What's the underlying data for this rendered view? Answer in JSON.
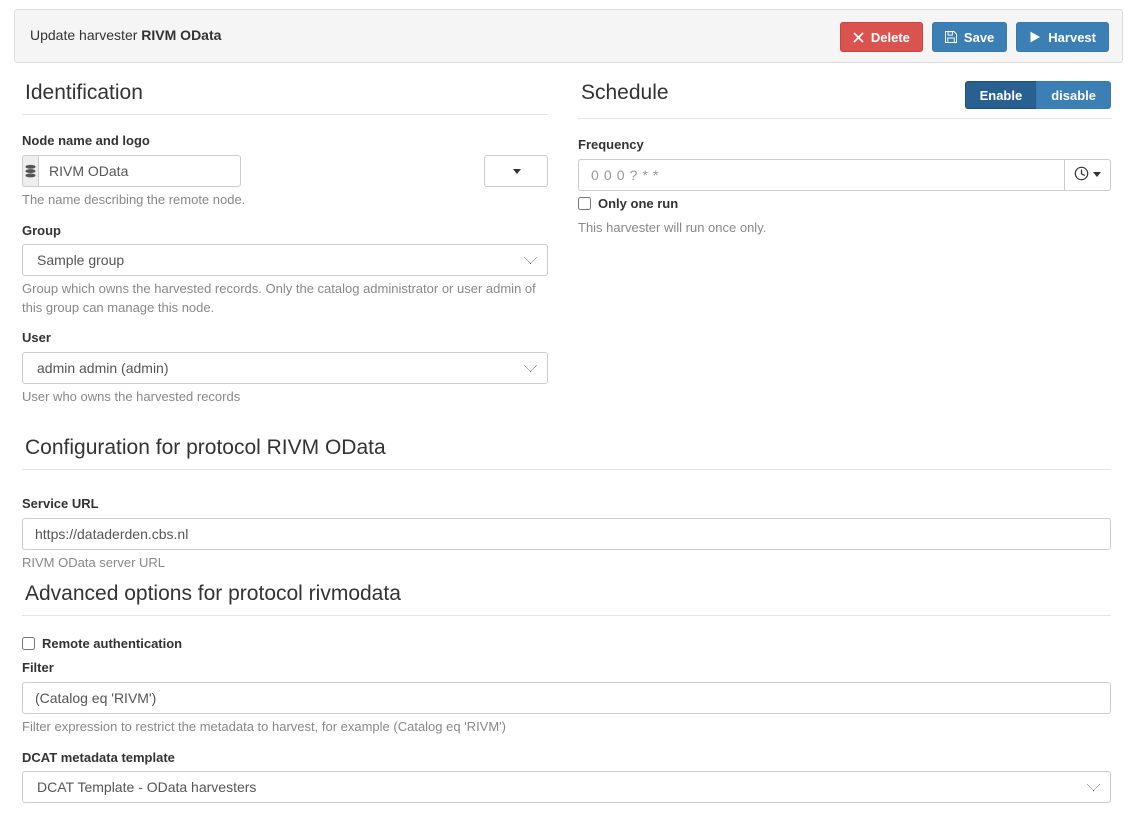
{
  "header": {
    "title_prefix": "Update harvester",
    "title_name": "RIVM OData",
    "buttons": [
      {
        "label": "Delete",
        "icon": "times-icon",
        "style": "danger"
      },
      {
        "label": "Save",
        "icon": "floppy-icon",
        "style": "primary"
      },
      {
        "label": "Harvest",
        "icon": "play-icon",
        "style": "primary"
      }
    ]
  },
  "identification": {
    "heading": "Identification",
    "node_name": {
      "label": "Node name and logo",
      "icon": "database-icon",
      "value": "RIVM OData",
      "help": "The name describing the remote node.",
      "logo_picker_label": ""
    },
    "group": {
      "label": "Group",
      "value": "Sample group",
      "options": [
        "Sample group"
      ],
      "help": "Group which owns the harvested records. Only the catalog administrator or user admin of this group can manage this node."
    },
    "user": {
      "label": "User",
      "value": "admin admin (admin)",
      "options": [
        "admin admin (admin)"
      ],
      "help": "User who owns the harvested records"
    }
  },
  "schedule": {
    "heading": "Schedule",
    "toggle": {
      "enable_label": "Enable",
      "disable_label": "disable",
      "active": "Enable"
    },
    "frequency": {
      "label": "Frequency",
      "value": "0 0 0 ? * *",
      "picker_icon": "clock-icon"
    },
    "only_one_run": {
      "label": "Only one run",
      "checked": false,
      "help": "This harvester will run once only."
    }
  },
  "configuration": {
    "heading": "Configuration for protocol RIVM OData",
    "service_url": {
      "label": "Service URL",
      "value": "https://dataderden.cbs.nl",
      "help": "RIVM OData server URL"
    }
  },
  "advanced": {
    "heading": "Advanced options for protocol rivmodata",
    "remote_auth": {
      "label": "Remote authentication",
      "checked": false
    },
    "filter": {
      "label": "Filter",
      "value": "(Catalog eq 'RIVM')",
      "help": "Filter expression to restrict the metadata to harvest, for example (Catalog eq 'RIVM')"
    },
    "dcat_template": {
      "label": "DCAT metadata template",
      "value": "DCAT Template - OData harvesters",
      "options": [
        "DCAT Template - OData harvesters"
      ]
    }
  },
  "colors": {
    "danger": "#d9534f",
    "primary": "#3b7fb5",
    "primary_active": "#286090",
    "panel_bg": "#f5f5f5",
    "border": "#dddddd",
    "help_text": "#888888"
  }
}
